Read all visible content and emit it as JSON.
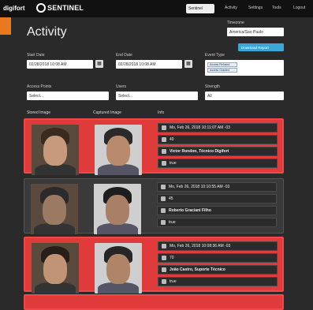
{
  "nav": {
    "logo_text": "digifort",
    "logo_sub": "SENTINEL",
    "server": "Sentinel",
    "items": [
      "Activity",
      "Settings",
      "Tools",
      "Logout"
    ]
  },
  "page": {
    "title": "Activity"
  },
  "filters": {
    "timezone_label": "Timezone",
    "timezone": "America/Sao Paulo",
    "download_label": "Download Report",
    "start_label": "Start Date",
    "start_value": "02/28/2018 10:08 AM",
    "end_label": "End Date",
    "end_value": "02/28/2018 10:08 AM",
    "event_label": "Event Type",
    "event_tags": [
      "Access Refused",
      "Access Granted"
    ],
    "ap_label": "Access Points",
    "ap_ph": "Select...",
    "users_label": "Users",
    "users_ph": "Select...",
    "strength_label": "Strength",
    "strength_value": "All"
  },
  "columns": {
    "stored": "Stored Image",
    "captured": "Captured Image",
    "info": "Info"
  },
  "events": [
    {
      "date": "Mo, Feb 26, 2018 10:11:07 AM -03",
      "score": "40",
      "name": "Victor Rondon, Técnico Digifort",
      "flag": "true",
      "alarm": true
    },
    {
      "date": "Mo, Feb 26, 2018 10:10:55 AM -03",
      "score": "45",
      "name": "Roberto Graciani Filho",
      "flag": "true",
      "alarm": false
    },
    {
      "date": "Mo, Feb 26, 2018 10:08:36 AM -03",
      "score": "70",
      "name": "João Castro, Suporte Técnico",
      "flag": "true",
      "alarm": true
    }
  ],
  "colors": {
    "alarm": "#df3b3b",
    "accent": "#e8791f",
    "download": "#3aa7d8"
  }
}
